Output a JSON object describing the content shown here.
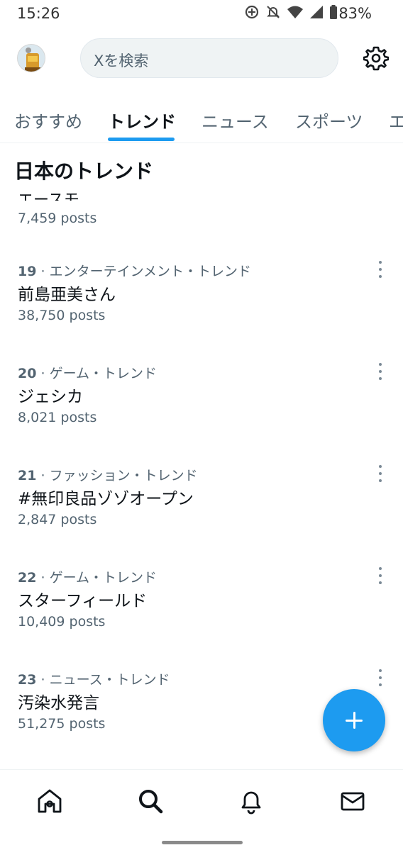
{
  "status_bar": {
    "time": "15:26",
    "battery": "83%"
  },
  "header": {
    "search_placeholder": "Xを検索"
  },
  "tabs": [
    {
      "label": "おすすめ"
    },
    {
      "label": "トレンド"
    },
    {
      "label": "ニュース"
    },
    {
      "label": "スポーツ"
    },
    {
      "label": "エ"
    }
  ],
  "section_title": "日本のトレンド",
  "partial_trend": {
    "name": "エースモ",
    "posts": "7,459 posts"
  },
  "trends": [
    {
      "rank": "19",
      "category": "エンターテインメント・トレンド",
      "name": "前島亜美さん",
      "posts": "38,750 posts"
    },
    {
      "rank": "20",
      "category": "ゲーム・トレンド",
      "name": "ジェシカ",
      "posts": "8,021 posts"
    },
    {
      "rank": "21",
      "category": "ファッション・トレンド",
      "name": "#無印良品ゾゾオープン",
      "posts": "2,847 posts"
    },
    {
      "rank": "22",
      "category": "ゲーム・トレンド",
      "name": "スターフィールド",
      "posts": "10,409 posts"
    },
    {
      "rank": "23",
      "category": "ニュース・トレンド",
      "name": "汚染水発言",
      "posts": "51,275 posts"
    }
  ],
  "colors": {
    "accent": "#1d9bf0",
    "text_primary": "#0f1419",
    "text_secondary": "#536471"
  },
  "icons": {
    "settings": "gear-icon",
    "compose": "plus-icon",
    "home": "home-icon",
    "search": "search-icon",
    "notifications": "bell-icon",
    "messages": "mail-icon"
  }
}
